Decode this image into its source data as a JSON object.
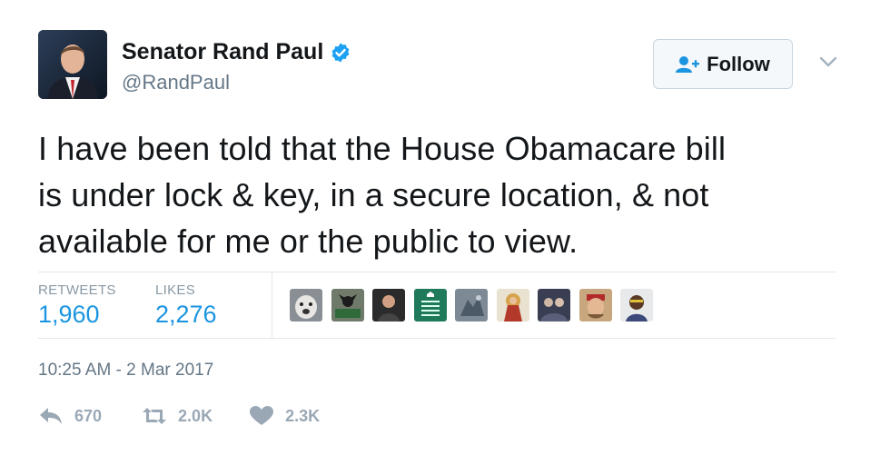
{
  "user": {
    "display_name": "Senator Rand Paul",
    "handle": "@RandPaul",
    "verified": true
  },
  "follow_button": {
    "label": "Follow"
  },
  "tweet": {
    "lines": [
      "I have been told that the House Obamacare bill",
      "is under lock & key, in a secure location, & not",
      "available for me or the public to view."
    ]
  },
  "stats": {
    "retweets_label": "RETWEETS",
    "retweets_value": "1,960",
    "likes_label": "LIKES",
    "likes_value": "2,276"
  },
  "timestamp": "10:25 AM - 2 Mar 2017",
  "actions": {
    "reply_count": "670",
    "retweet_count": "2.0K",
    "like_count": "2.3K"
  },
  "colors": {
    "link_blue": "#1b95e0",
    "verified_blue": "#1da1f2",
    "muted": "#657786",
    "action_grey": "#9aa8b5"
  }
}
